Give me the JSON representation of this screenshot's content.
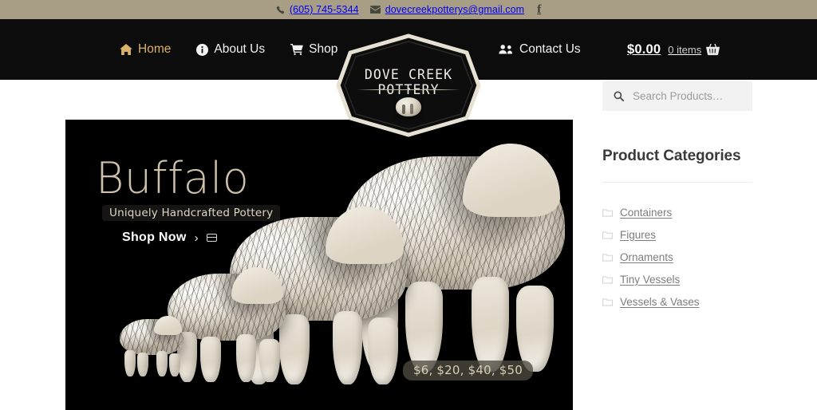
{
  "topbar": {
    "phone": "(605) 745-5344",
    "email": "dovecreekpotterys@gmail.com",
    "phone_icon": "phone-icon",
    "email_icon": "envelope-icon",
    "facebook_icon": "facebook-icon",
    "facebook_label": "f",
    "background_color": "#a89e85"
  },
  "nav": {
    "background_color": "#0c0c0c",
    "active_color": "#d9b169",
    "items": [
      {
        "label": "Home",
        "icon": "home-icon",
        "active": true
      },
      {
        "label": "About Us",
        "icon": "info-circle-icon",
        "active": false
      },
      {
        "label": "Shop",
        "icon": "shopping-cart-icon",
        "active": false
      },
      {
        "label": "Contact Us",
        "icon": "users-icon",
        "active": false
      }
    ],
    "cart": {
      "total": "$0.00",
      "count": "0 items",
      "icon": "shopping-basket-icon"
    }
  },
  "logo": {
    "text": "Dove Creek Pottery",
    "shape": "hexagon-badge",
    "border_color": "#e6e1d2",
    "fill_color": "#0d0d0d"
  },
  "hero": {
    "title": "Buffalo",
    "subtitle": "Uniquely Handcrafted Pottery",
    "cta_label": "Shop Now",
    "cta_chevron": "›",
    "cta_icon": "card-icon",
    "price_label": "$6, $20, $40, $50",
    "background_color": "#000000",
    "title_color": "#cdc1ac"
  },
  "sidebar": {
    "search": {
      "placeholder": "Search Products…",
      "icon": "search-icon"
    },
    "categories_title": "Product Categories",
    "categories": [
      {
        "label": "Containers",
        "icon": "folder-icon"
      },
      {
        "label": "Figures",
        "icon": "folder-icon"
      },
      {
        "label": "Ornaments",
        "icon": "folder-icon"
      },
      {
        "label": "Tiny Vessels",
        "icon": "folder-icon"
      },
      {
        "label": "Vessels & Vases",
        "icon": "folder-icon"
      }
    ]
  }
}
